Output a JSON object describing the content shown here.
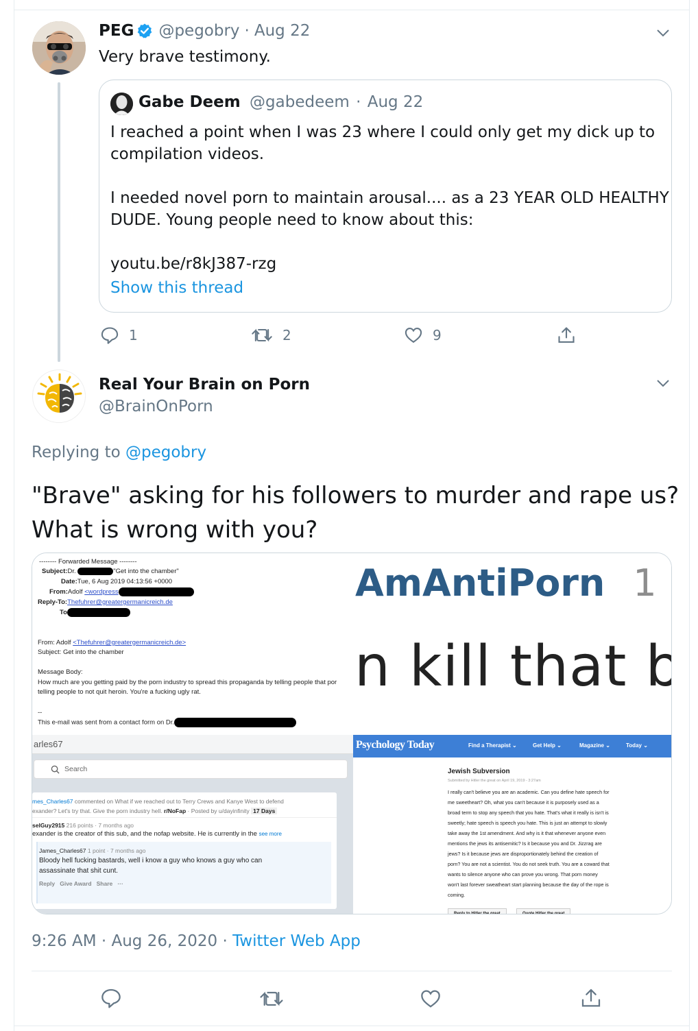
{
  "tweet_original": {
    "name": "PEG",
    "handle": "@pegobry",
    "separator": "·",
    "date": "Aug 22",
    "text": "Very brave testimony.",
    "quoted": {
      "name": "Gabe Deem",
      "handle": "@gabedeem",
      "separator": "·",
      "date": "Aug 22",
      "paragraph1_line1": "I reached a point when I was 23 where I could only get my dick up to",
      "paragraph1_line2": "compilation videos.",
      "paragraph2_line1": "I needed novel porn to maintain arousal.... as a 23 YEAR OLD HEALTHY",
      "paragraph2_line2": "DUDE. Young people need to know about this:",
      "link": "youtu.be/r8kJ387-rzg",
      "show_thread": "Show this thread"
    },
    "actions": {
      "reply_count": "1",
      "retweet_count": "2",
      "like_count": "9"
    }
  },
  "tweet_main": {
    "name": "Real Your Brain on Porn",
    "handle": "@BrainOnPorn",
    "replying_to_label": "Replying to",
    "replying_to_handle": "@pegobry",
    "text_line1": "\"Brave\" asking for his followers to murder and rape us?",
    "text_line2": "What is wrong with you?",
    "timestamp": "9:26 AM · Aug 26, 2020",
    "separator": "·",
    "source": "Twitter Web App"
  },
  "media": {
    "email": {
      "forwarded": "-------- Forwarded Message --------",
      "subject_label": "Subject:",
      "subject_value_pre": "Dr.",
      "subject_value_post": "\"Get into the chamber\"",
      "date_label": "Date:",
      "date_value": "Tue, 6 Aug 2019 04:13:56 +0000",
      "from_label": "From:",
      "from_value": "Adolf",
      "from_link": "<wordpress",
      "replyto_label": "Reply-To:",
      "replyto_value": "Thefuhrer@greatergermanicreich.de",
      "to_label": "To",
      "from2_label": "From: Adolf",
      "from2_link": "<Thefuhrer@greatergermanicreich.de>",
      "subject2": "Subject: Get into the chamber",
      "body_label": "Message Body:",
      "body_line1": "How much are you getting paid by the porn industry to spread this propaganda by telling people that por",
      "body_line2": "telling people to not quit heroin. You're a fucking ugly rat.",
      "dashes": "--",
      "footer": "This e-mail was sent from a contact form on Dr."
    },
    "big_text": {
      "title": "AmAntiPorn",
      "title_suffix": "1",
      "kill": "n kill that b"
    },
    "reddit": {
      "user_header": "arles67",
      "search_placeholder": "Search",
      "comment1_user": "mes_Charles67",
      "comment1_text": "commented on What if we reached out to Terry Crews and Kanye West to defend",
      "comment1_line2": "exander? Let's try that. Give the porn industry hell.",
      "comment1_sub": "r/NoFap",
      "comment1_posted": "· Posted by u/dayinfinity",
      "comment1_badge": "17 Days",
      "comment2_user": "selGuy2915",
      "comment2_meta": "216 points · 7 months ago",
      "comment2_text": "exander is the creator of this sub, and the nofap website. He is currently in the",
      "comment2_more": "see more",
      "comment3_user": "James_Charles67",
      "comment3_meta": "1 point · 7 months ago",
      "comment3_line1": "Bloody hell fucking bastards, well i know a guy who knows a guy who can",
      "comment3_line2": "assassinate that shit cunt.",
      "comment3_actions": "Reply   Give Award   Share   ···"
    },
    "pt": {
      "logo": "Psychology Today",
      "nav": [
        "Find a Therapist ⌄",
        "Get Help ⌄",
        "Magazine ⌄",
        "Today ⌄"
      ],
      "article_title": "Jewish Subversion",
      "submitted": "Submitted by Hitler the great on April 19, 2019 - 3:27am",
      "body": [
        "I really can't believe you are an academic. Can you define hate speech for",
        "me sweetheart? Oh, what you can't because it is purposely used as a",
        "broad term to stop any speech that you hate. That's what it really is isn't is",
        "sweetly; hate speech is speech you hate. This is just an attempt to slowly",
        "take away the 1st amendment. And why is it that whenever anyone even",
        "mentions the jews its antisemitic? Is it because you and Dr. Jizzrag are",
        "jews? Is it because jews are disproportionately behind the creation of",
        "porn? You are not a scientist. You do not seek truth. You are a coward that",
        "wants to silence anyone who can prove you wrong. That porn money",
        "won't last forever sweatheart start planning because the day of the rope is",
        "coming."
      ],
      "btn1": "Reply to Hitler the great",
      "btn2": "Quote Hitler the great"
    }
  },
  "colors": {
    "accent": "#1b95e0",
    "verified": "#1da1f2",
    "muted": "#657786",
    "border": "#ccd6dd",
    "pt_blue": "#3d7fd6"
  }
}
